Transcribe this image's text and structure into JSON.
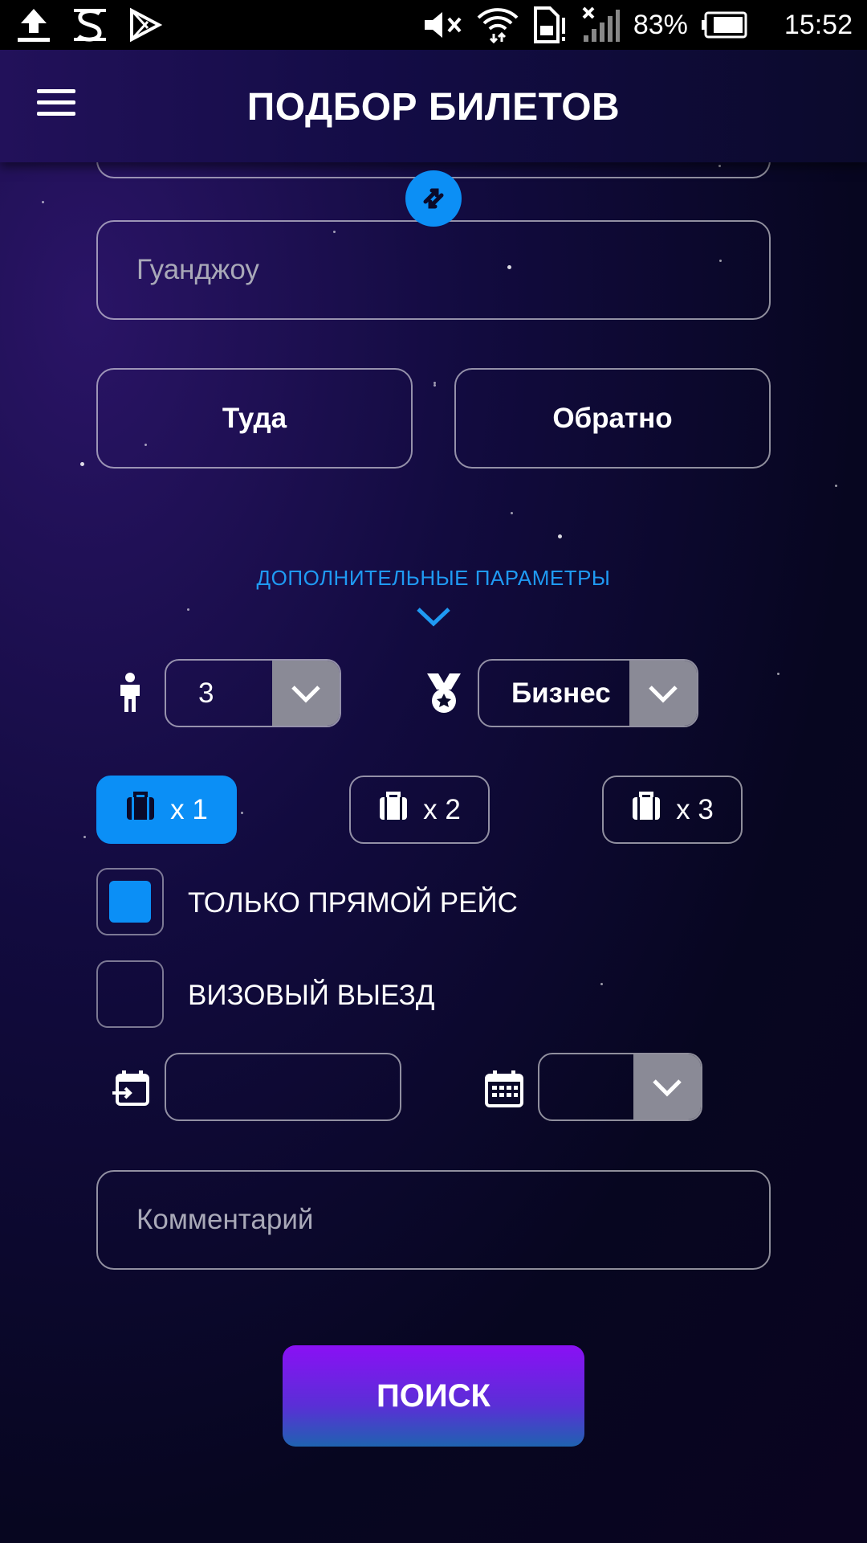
{
  "status_bar": {
    "battery": "83%",
    "time": "15:52",
    "left_icons": [
      "upload-icon",
      "s-app-icon",
      "play-store-icon"
    ],
    "right_icons": [
      "mute-icon",
      "wifi-icon",
      "sim-icon",
      "signal-icon",
      "battery-icon"
    ]
  },
  "header": {
    "title": "ПОДБОР БИЛЕТОВ",
    "menu_icon": "hamburger-icon"
  },
  "form": {
    "destination_placeholder": "Гуанджоу",
    "swap_icon": "swap-arrows-icon",
    "depart_label": "Туда",
    "return_label": "Обратно",
    "extra_params_label": "ДОПОЛНИТЕЛЬНЫЕ ПАРАМЕТРЫ",
    "passengers": {
      "icon": "person-icon",
      "value": "3"
    },
    "class": {
      "icon": "medal-icon",
      "value": "Бизнес"
    },
    "baggage": [
      {
        "label": "x 1",
        "active": true
      },
      {
        "label": "x 2",
        "active": false
      },
      {
        "label": "x 3",
        "active": false
      }
    ],
    "direct_only": {
      "label": "ТОЛЬКО ПРЯМОЙ РЕЙС",
      "checked": true
    },
    "visa_run": {
      "label": "ВИЗОВЫЙ ВЫЕЗД",
      "checked": false
    },
    "date_input_value": "",
    "day_select_value": "",
    "comment_placeholder": "Комментарий",
    "search_label": "ПОИСК"
  },
  "colors": {
    "accent": "#0b8ff6",
    "button_gradient_top": "#8a10f5",
    "button_gradient_bottom": "#1f63b0",
    "select_arrow_bg": "#8a8a96"
  }
}
